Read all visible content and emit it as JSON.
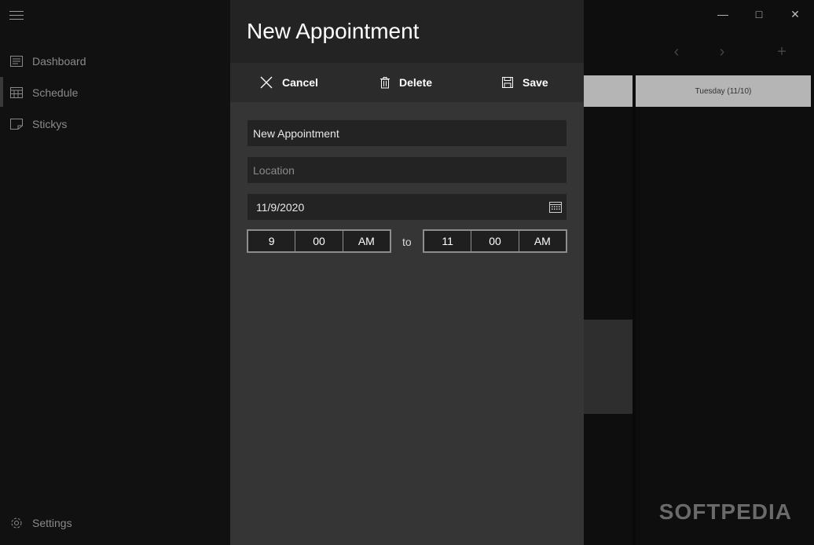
{
  "nav": {
    "items": [
      {
        "label": "Dashboard",
        "icon": "dashboard-icon"
      },
      {
        "label": "Schedule",
        "icon": "calendar-icon"
      },
      {
        "label": "Stickys",
        "icon": "sticky-note-icon"
      }
    ],
    "settings_label": "Settings"
  },
  "calendar": {
    "day_header": "Tuesday (11/10)"
  },
  "dialog": {
    "title": "New Appointment",
    "toolbar": {
      "cancel_label": "Cancel",
      "delete_label": "Delete",
      "save_label": "Save"
    },
    "title_field_value": "New Appointment",
    "location_placeholder": "Location",
    "date_value": "11/9/2020",
    "start_time": {
      "hour": "9",
      "minute": "00",
      "period": "AM"
    },
    "to_label": "to",
    "end_time": {
      "hour": "11",
      "minute": "00",
      "period": "AM"
    }
  },
  "watermark": "SOFTPEDIA",
  "colors": {
    "dialog_bg": "#353535",
    "header_bg": "#232323",
    "day_header_bg": "#b5b5b5"
  }
}
